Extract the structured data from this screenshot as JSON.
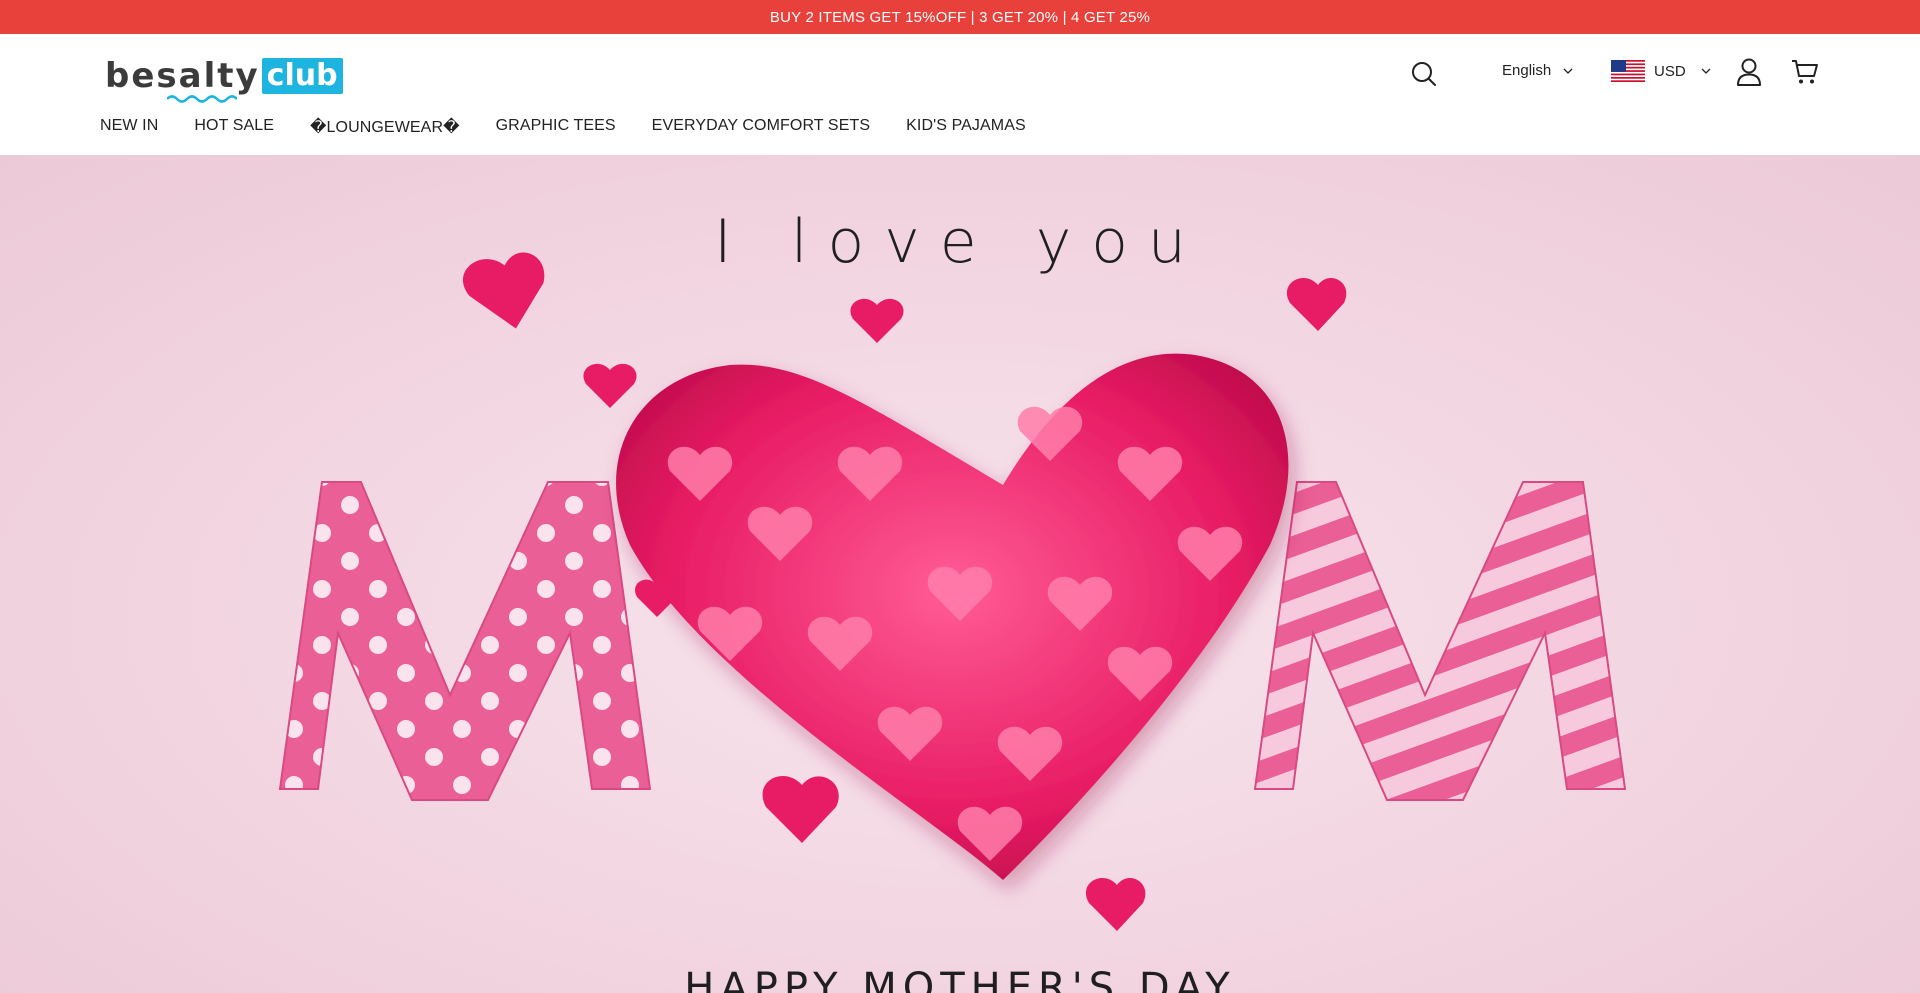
{
  "announcement": "BUY 2 ITEMS GET 15%OFF | 3 GET 20% | 4 GET 25%",
  "logo": {
    "main": "besalty",
    "accent": "club"
  },
  "header": {
    "language": "English",
    "currency": "USD"
  },
  "nav": [
    {
      "label": "NEW IN"
    },
    {
      "label": "HOT SALE"
    },
    {
      "label": "�LOUNGEWEAR�"
    },
    {
      "label": "GRAPHIC TEES"
    },
    {
      "label": "EVERYDAY COMFORT SETS"
    },
    {
      "label": "KID'S PAJAMAS"
    }
  ],
  "hero": {
    "title": "I love you",
    "subtitle": "HAPPY MOTHER'S DAY"
  },
  "colors": {
    "announcement_bg": "#e8403b",
    "logo_accent": "#1db4df",
    "heart_pink": "#e81c64"
  },
  "icons": [
    "search-icon",
    "chevron-down-icon",
    "us-flag-icon",
    "user-icon",
    "cart-icon"
  ]
}
